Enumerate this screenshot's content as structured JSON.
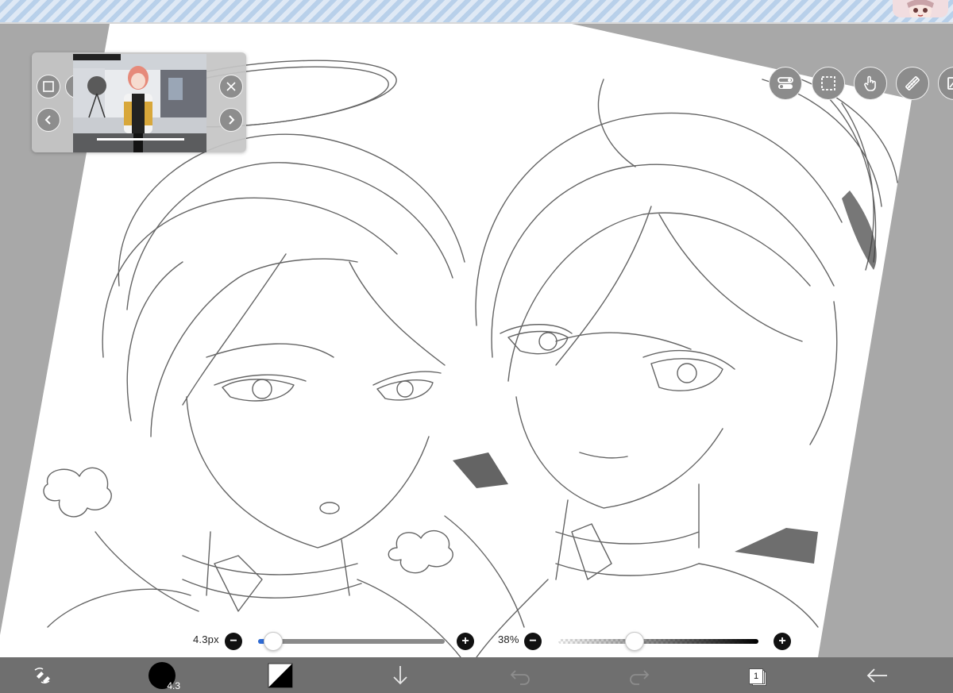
{
  "toolbar": {
    "brush_size_label": "4.3px",
    "brush_size_indicator": "4.3",
    "opacity_label": "38%",
    "layer_count": "1"
  },
  "sliders": {
    "brush_size_fraction": 0.08,
    "opacity_fraction": 0.38
  },
  "icons": {
    "reference_window": [
      "frame-icon",
      "more-icon",
      "close-icon",
      "prev-icon",
      "next-icon"
    ],
    "top_tools": [
      "toggle-icon",
      "selection-icon",
      "hand-icon",
      "ruler-icon",
      "image-icon"
    ],
    "bottom_tools": [
      "pen-eraser-swap-icon",
      "brush-size-icon",
      "color-icon",
      "download-icon",
      "undo-icon",
      "redo-icon",
      "layers-icon",
      "back-icon"
    ]
  },
  "colors": {
    "workspace_bg": "#a8a8a8",
    "paper": "#ffffff",
    "bottom_bar": "#6f6f6f",
    "accent": "#2e6bd6"
  }
}
